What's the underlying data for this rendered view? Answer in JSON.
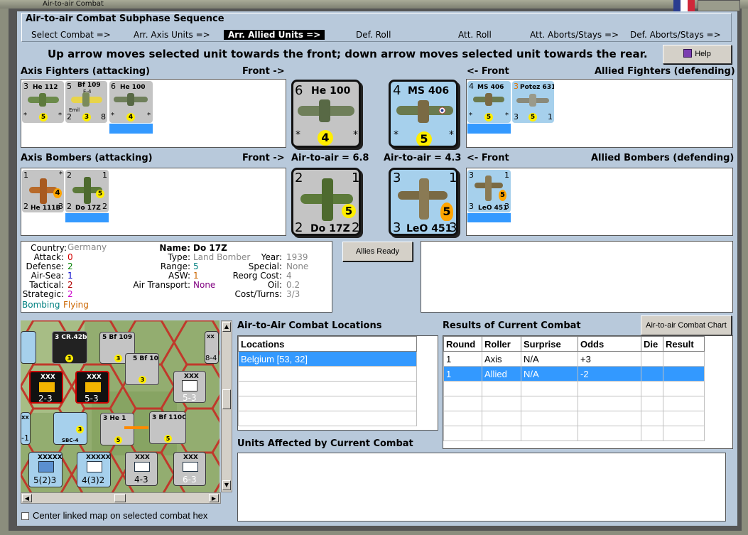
{
  "window": {
    "title": "Air-to-air Combat"
  },
  "sequence": {
    "group_title": "Air-to-air Combat Subphase Sequence",
    "steps": [
      "Select Combat =>",
      "Arr. Axis Units =>",
      "Arr. Allied Units =>",
      "Def. Roll",
      "Att. Roll",
      "Att. Aborts/Stays =>",
      "Def. Aborts/Stays =>"
    ],
    "active_index": 2
  },
  "instruction": "Up arrow moves selected unit towards the front; down arrow moves selected unit towards the rear.",
  "help_button": "Help",
  "axis_fighters": {
    "title": "Axis Fighters (attacking)",
    "front_label": "Front ->",
    "units": [
      {
        "tl": "3",
        "name": "He 112",
        "star": "*",
        "dot": "5",
        "bl": "*",
        "br": "*"
      },
      {
        "tl": "5",
        "name": "Bf 109",
        "sub": "E-4",
        "sub2": "Emil",
        "dot": "3",
        "bl": "2",
        "br": "8"
      },
      {
        "tl": "6",
        "name": "He 100",
        "dot": "4",
        "bl": "*",
        "br": "*"
      }
    ]
  },
  "axis_front_fighter": {
    "tl": "6",
    "name": "He 100",
    "dot": "4",
    "bl": "*",
    "br": "*"
  },
  "allied_front_fighter": {
    "tl": "4",
    "name": "MS 406",
    "dot": "5",
    "bl": "*",
    "br": "*"
  },
  "allied_fighters": {
    "title": "Allied Fighters (defending)",
    "front_label": "<- Front",
    "units": [
      {
        "tl": "4",
        "name": "MS 406",
        "dot": "5",
        "bl": "*",
        "br": "*"
      },
      {
        "tl": "3",
        "name": "Potez 631",
        "dot": "5",
        "bl": "3",
        "br": "1"
      }
    ]
  },
  "axis_bombers": {
    "title": "Axis Bombers (attacking)",
    "front_label": "Front ->",
    "units": [
      {
        "tl": "1",
        "tr": "*",
        "name": "He 111B",
        "dot": "4",
        "bl": "2",
        "br": "3"
      },
      {
        "tl": "2",
        "tr": "1",
        "name": "Do 17Z",
        "dot": "5",
        "bl": "2",
        "br": "2"
      }
    ]
  },
  "air_to_air_axis": "Air-to-air = 6.8",
  "air_to_air_allied": "Air-to-air = 4.3",
  "axis_front_bomber": {
    "tl": "2",
    "tr": "1",
    "name": "Do 17Z",
    "dot": "5",
    "bl": "2",
    "br": "2"
  },
  "allied_front_bomber": {
    "tl": "3",
    "tr": "1",
    "name": "LeO 451",
    "dot": "5",
    "bl": "3",
    "br": "3"
  },
  "allied_bombers": {
    "title": "Allied Bombers (defending)",
    "front_label": "<- Front",
    "units": [
      {
        "tl": "3",
        "tr": "1",
        "name": "LeO 451",
        "dot": "5",
        "bl": "3",
        "br": "3"
      }
    ]
  },
  "unit_info": {
    "country_k": "Country:",
    "country": "Germany",
    "attack_k": "Attack:",
    "attack": "0",
    "defense_k": "Defense:",
    "defense": "2",
    "airsea_k": "Air-Sea:",
    "airsea": "1",
    "tactical_k": "Tactical:",
    "tactical": "2",
    "strategic_k": "Strategic:",
    "strategic": "2",
    "mission1": "Bombing",
    "mission2": "Flying",
    "name_k": "Name:",
    "name": "Do 17Z",
    "type_k": "Type:",
    "type": "Land Bomber",
    "range_k": "Range:",
    "range": "5",
    "asw_k": "ASW:",
    "asw": "1",
    "transport_k": "Air Transport:",
    "transport": "None",
    "year_k": "Year:",
    "year": "1939",
    "special_k": "Special:",
    "special": "None",
    "reorg_k": "Reorg Cost:",
    "reorg": "4",
    "oil_k": "Oil:",
    "oil": "0.2",
    "cost_k": "Cost/Turns:",
    "cost": "3/3"
  },
  "allies_ready_button": "Allies Ready",
  "locations": {
    "title": "Air-to-Air Combat Locations",
    "header": "Locations",
    "rows": [
      "Belgium [53, 32]"
    ]
  },
  "results": {
    "title": "Results of Current Combat",
    "chart_button": "Air-to-air Combat Chart",
    "columns": [
      "Round",
      "Roller",
      "Surprise",
      "Odds",
      "Die",
      "Result"
    ],
    "rows": [
      [
        "1",
        "Axis",
        "N/A",
        "+3",
        "",
        ""
      ],
      [
        "1",
        "Allied",
        "N/A",
        "-2",
        "",
        ""
      ]
    ]
  },
  "affected": {
    "title": "Units Affected by Current Combat"
  },
  "center_map": {
    "label": "Center linked map on selected combat hex",
    "checked": false
  },
  "map": {
    "counters": [
      {
        "t": "3 CR.42bis",
        "b": "3"
      },
      {
        "t": "5 Bf 109",
        "b": "3"
      },
      {
        "t": "XXX",
        "b": "2-3"
      },
      {
        "t": "XXX",
        "b": "5-3"
      },
      {
        "t": "5 Bf 109",
        "b": "3"
      },
      {
        "t": "XXX",
        "b": "5-3"
      },
      {
        "t": "3 He 1",
        "b": "5"
      },
      {
        "t": "3 Bf 110C",
        "b": "5"
      },
      {
        "t": "XXXXX",
        "b": "5(2)3"
      },
      {
        "t": "XXXXX",
        "b": "4(3)2"
      },
      {
        "t": "XXX",
        "b": "4-3"
      },
      {
        "t": "XXX",
        "b": "6-3"
      },
      {
        "t": "SBC-4",
        "b": "3"
      },
      {
        "t": "XX",
        "b": "-1"
      },
      {
        "t": "XX",
        "b": "8-4"
      }
    ]
  },
  "colors": {
    "attack": "#d40000",
    "defense": "#008000",
    "airsea": "#0000cc",
    "tactical": "#b00000",
    "strategic": "#cc00cc",
    "gray": "#888888",
    "range": "#008080",
    "asw": "#cc6600",
    "transport": "#800080",
    "accent": "#3399ff"
  }
}
